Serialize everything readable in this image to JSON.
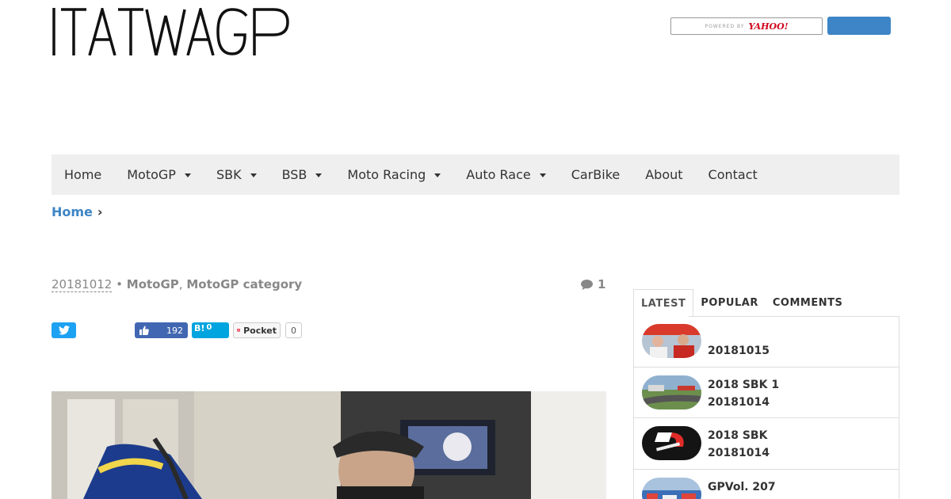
{
  "site": {
    "logo_text": "ITATWAGP"
  },
  "search": {
    "powered_by": "POWERED BY",
    "provider": "YAHOO!"
  },
  "nav": {
    "items": [
      {
        "label": "Home",
        "dropdown": false
      },
      {
        "label": "MotoGP",
        "dropdown": true
      },
      {
        "label": "SBK",
        "dropdown": true
      },
      {
        "label": "BSB",
        "dropdown": true
      },
      {
        "label": "Moto Racing",
        "dropdown": true
      },
      {
        "label": "Auto Race",
        "dropdown": true
      },
      {
        "label": "CarBike",
        "dropdown": false
      },
      {
        "label": "About",
        "dropdown": false
      },
      {
        "label": "Contact",
        "dropdown": false
      }
    ]
  },
  "breadcrumb": {
    "home": "Home",
    "separator": "›"
  },
  "post": {
    "date": "20181012",
    "bullet": "•",
    "categories": [
      "MotoGP",
      "MotoGP category"
    ],
    "cat_separator": ",",
    "comment_count": "1"
  },
  "share": {
    "facebook_count": "192",
    "hatena_label": "B!",
    "hatena_count": "0",
    "pocket_label": "Pocket",
    "pocket_count": "0"
  },
  "sidebar": {
    "tabs": [
      {
        "label": "LATEST",
        "active": true
      },
      {
        "label": "POPULAR",
        "active": false
      },
      {
        "label": "COMMENTS",
        "active": false
      }
    ],
    "posts": [
      {
        "title": "",
        "date": "20181015",
        "thumb": "press-conference"
      },
      {
        "title": "2018 SBK 1",
        "date": "20181014",
        "thumb": "race-track"
      },
      {
        "title": "2018 SBK",
        "date": "20181014",
        "thumb": "sbk-logo"
      },
      {
        "title": "GPVol. 207",
        "date": "",
        "thumb": "paddock"
      }
    ]
  },
  "colors": {
    "accent": "#3d85c6",
    "nav_bg": "#efefef",
    "twitter": "#1da1f2",
    "facebook": "#4267b2",
    "hatena": "#00a4de"
  }
}
